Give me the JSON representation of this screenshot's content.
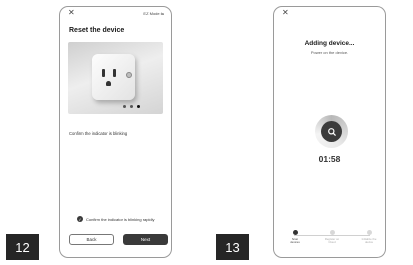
{
  "page_numbers": {
    "left": "12",
    "right": "13"
  },
  "reset_screen": {
    "close_glyph": "✕",
    "mode_label": "EZ Mode",
    "mode_icon": "swap-icon",
    "title": "Reset the device",
    "instruction": "Confirm the indicator is blinking",
    "confirm_checkbox_label": "Confirm the indicator is blinking rapidly",
    "confirm_checked": true,
    "back_label": "Back",
    "next_label": "Next"
  },
  "adding_screen": {
    "close_glyph": "✕",
    "title": "Adding device...",
    "subtitle": "Power on the device.",
    "timer": "01:58",
    "steps": [
      {
        "line1": "Scan",
        "line2": "devices",
        "active": true
      },
      {
        "line1": "Register on",
        "line2": "Cloud",
        "active": false
      },
      {
        "line1": "Initialize the",
        "line2": "device",
        "active": false
      }
    ]
  }
}
